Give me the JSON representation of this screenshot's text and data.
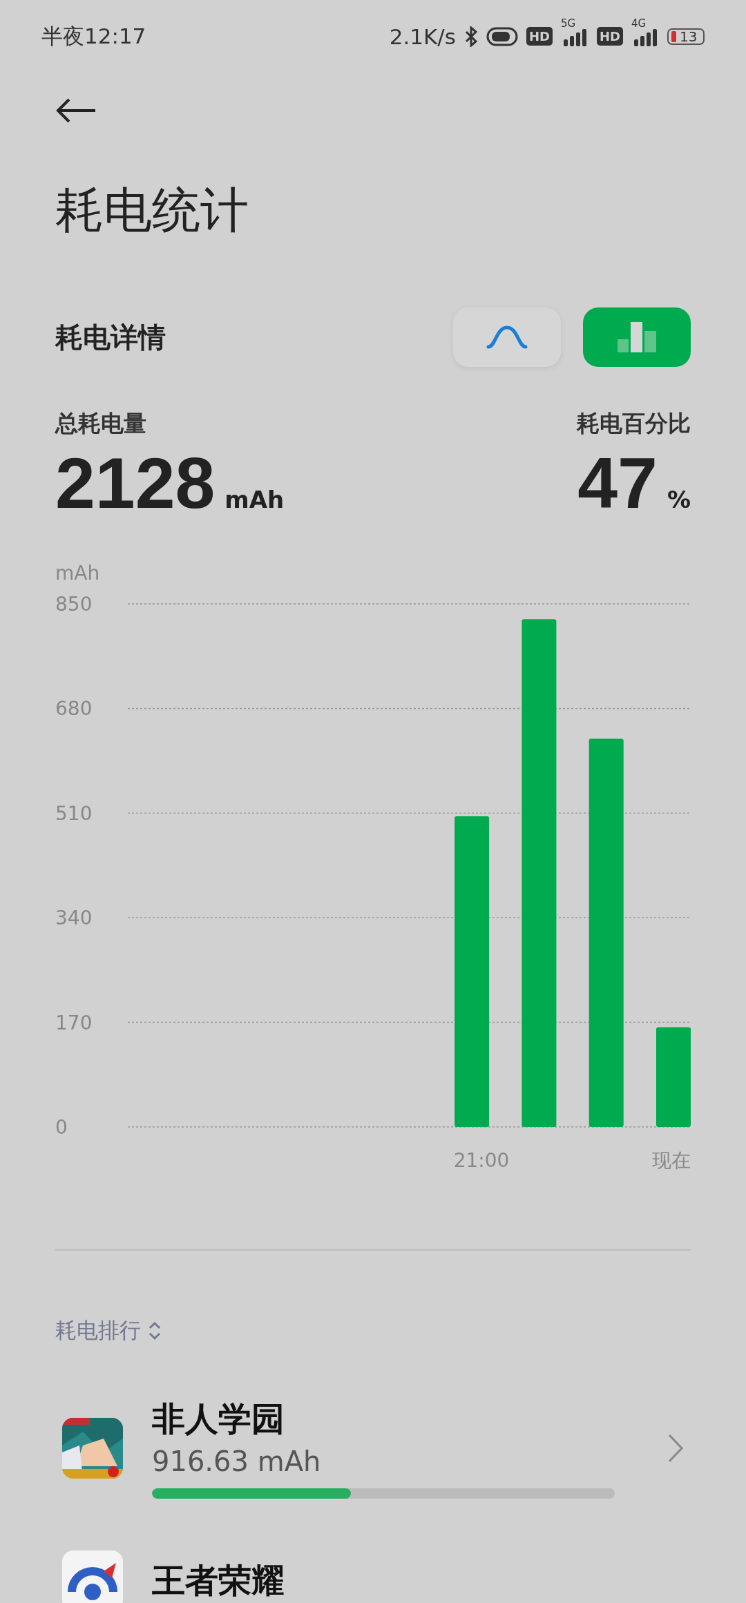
{
  "status_bar": {
    "time": "半夜12:17",
    "net_speed": "2.1K/s",
    "sims": [
      {
        "hd": "HD",
        "network": "5G"
      },
      {
        "hd": "HD",
        "network": "4G"
      }
    ],
    "battery": "13"
  },
  "title": "耗电统计",
  "detail": {
    "title": "耗电详情",
    "views": [
      {
        "kind": "curve",
        "selected": false
      },
      {
        "kind": "bar",
        "selected": true
      }
    ]
  },
  "totals": [
    {
      "label": "总耗电量",
      "value": "2128",
      "unit": "mAh"
    },
    {
      "label": "耗电百分比",
      "value": "47",
      "unit": "%"
    }
  ],
  "chart_data": {
    "type": "bar",
    "ylabel": "mAh",
    "values": [
      null,
      null,
      null,
      null,
      505,
      825,
      631,
      162
    ],
    "ylim": [
      0,
      850
    ],
    "yticks": [
      0,
      170,
      340,
      510,
      680,
      850
    ],
    "grid": true,
    "categories": [
      null,
      null,
      null,
      null,
      "21:00",
      null,
      null,
      "现在"
    ]
  },
  "ranking": {
    "title": "耗电排行",
    "apps": [
      {
        "name": "非人学园",
        "usage": "916.63 mAh",
        "level": 0.43
      },
      {
        "name": "王者荣耀"
      }
    ]
  }
}
